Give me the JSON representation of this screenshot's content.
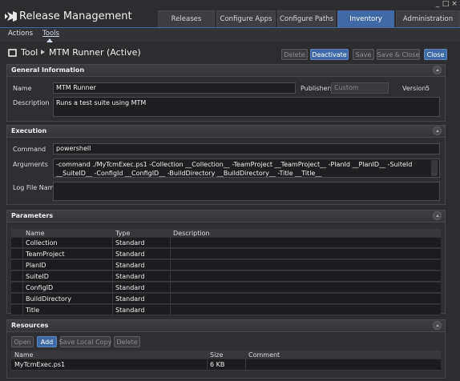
{
  "app": {
    "title": "Release Management"
  },
  "window_controls": {
    "minimize": "_",
    "maximize": "□",
    "close": "×"
  },
  "tabs": [
    {
      "label": "Releases"
    },
    {
      "label": "Configure Apps"
    },
    {
      "label": "Configure Paths"
    },
    {
      "label": "Inventory"
    },
    {
      "label": "Administration"
    }
  ],
  "subnav": [
    {
      "label": "Actions"
    },
    {
      "label": "Tools"
    }
  ],
  "header": {
    "crumb": "Tool",
    "title": "MTM Runner (Active)",
    "buttons": {
      "delete": "Delete",
      "deactivate": "Deactivate",
      "save": "Save",
      "save_close": "Save & Close",
      "close": "Close"
    }
  },
  "general": {
    "title": "General Information",
    "name_label": "Name",
    "name_value": "MTM Runner",
    "publishers_label": "Publishers",
    "publishers_value": "Custom",
    "version_label": "Version",
    "version_value": "5",
    "description_label": "Description",
    "description_value": "Runs a test suite using MTM"
  },
  "execution": {
    "title": "Execution",
    "command_label": "Command",
    "command_value": "powershell",
    "arguments_label": "Arguments",
    "arguments_value": "-command ./MyTcmExec.ps1 -Collection __Collection__ -TeamProject __TeamProject__ -PlanId __PlanID__ -SuiteId __SuiteID__ -ConfigId __ConfigID__ -BuildDirectory __BuildDirectory__ -Title __Title__",
    "logfile_label": "Log File Name",
    "logfile_value": ""
  },
  "parameters": {
    "title": "Parameters",
    "columns": [
      "Name",
      "Type",
      "Description"
    ],
    "rows": [
      {
        "name": "Collection",
        "type": "Standard",
        "description": ""
      },
      {
        "name": "TeamProject",
        "type": "Standard",
        "description": ""
      },
      {
        "name": "PlanID",
        "type": "Standard",
        "description": ""
      },
      {
        "name": "SuiteID",
        "type": "Standard",
        "description": ""
      },
      {
        "name": "ConfigID",
        "type": "Standard",
        "description": ""
      },
      {
        "name": "BuildDirectory",
        "type": "Standard",
        "description": ""
      },
      {
        "name": "Title",
        "type": "Standard",
        "description": ""
      }
    ]
  },
  "resources": {
    "title": "Resources",
    "buttons": {
      "open": "Open",
      "add": "Add",
      "save_local": "Save Local Copy",
      "delete": "Delete"
    },
    "columns": [
      "Name",
      "Size",
      "Comment"
    ],
    "rows": [
      {
        "name": "MyTcmExec.ps1",
        "size": "6 KB",
        "comment": ""
      }
    ]
  },
  "colors": {
    "accent": "#3f6aa6",
    "background": "#2d2d30",
    "field": "#1f1f21"
  },
  "icons": [
    "vs-logo-icon",
    "tool-icon",
    "chevron-right-icon",
    "collapse-icon"
  ]
}
